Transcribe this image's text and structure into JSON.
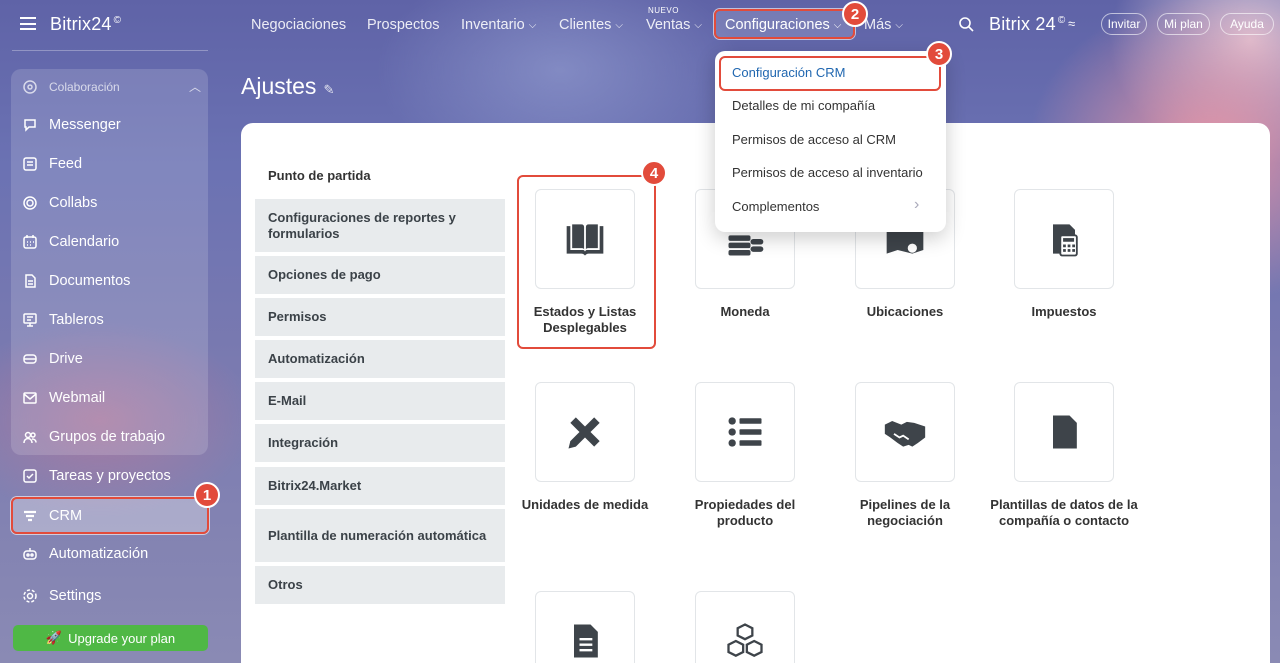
{
  "sidebar": {
    "logo": "Bitrix24",
    "logo_mark": "©",
    "group_title": "Colaboración",
    "items": [
      {
        "label": "Messenger",
        "icon": "messenger-icon"
      },
      {
        "label": "Feed",
        "icon": "feed-icon"
      },
      {
        "label": "Collabs",
        "icon": "collabs-icon"
      },
      {
        "label": "Calendario",
        "icon": "calendar-icon"
      },
      {
        "label": "Documentos",
        "icon": "document-icon"
      },
      {
        "label": "Tableros",
        "icon": "board-icon"
      },
      {
        "label": "Drive",
        "icon": "drive-icon"
      },
      {
        "label": "Webmail",
        "icon": "mail-icon"
      },
      {
        "label": "Grupos de trabajo",
        "icon": "groups-icon"
      }
    ],
    "tasks": "Tareas y proyectos",
    "crm": "CRM",
    "automation": "Automatización",
    "settings": "Settings",
    "upgrade": "Upgrade your plan"
  },
  "topbar": {
    "nav": [
      "Negociaciones",
      "Prospectos",
      "Inventario",
      "Clientes",
      "Ventas",
      "Configuraciones",
      "Más"
    ],
    "nuevo": "NUEVO",
    "brand": "Bitrix 24",
    "brand_mark": "©",
    "invite": "Invitar",
    "plan": "Mi plan",
    "help": "Ayuda"
  },
  "page": {
    "title": "Ajustes",
    "section_head": "Punto de partida",
    "menu": [
      "Configuraciones de reportes y formularios",
      "Opciones de pago",
      "Permisos",
      "Automatización",
      "E-Mail",
      "Integración",
      "Bitrix24.Market",
      "Plantilla de numeración automática",
      "Otros"
    ],
    "tiles": [
      {
        "label": "Estados y Listas Desplegables",
        "icon": "book-icon"
      },
      {
        "label": "Moneda",
        "icon": "coins-icon"
      },
      {
        "label": "Ubicaciones",
        "icon": "map-pin-icon"
      },
      {
        "label": "Impuestos",
        "icon": "calculator-icon"
      },
      {
        "label": "Unidades de medida",
        "icon": "ruler-pencil-icon"
      },
      {
        "label": "Propiedades del producto",
        "icon": "list-icon"
      },
      {
        "label": "Pipelines de la negociación",
        "icon": "handshake-icon"
      },
      {
        "label": "Plantillas de datos de la compañía o contacto",
        "icon": "file-icon"
      },
      {
        "label": "",
        "icon": "file-text-icon"
      },
      {
        "label": "",
        "icon": "cubes-icon"
      }
    ]
  },
  "dropdown": {
    "items": [
      "Configuración CRM",
      "Detalles de mi compañía",
      "Permisos de acceso al CRM",
      "Permisos de acceso al inventario",
      "Complementos"
    ]
  },
  "badges": [
    "1",
    "2",
    "3",
    "4"
  ],
  "colors": {
    "highlight": "#e24b3b",
    "upgrade": "#4fb845",
    "link": "#2067b0"
  }
}
